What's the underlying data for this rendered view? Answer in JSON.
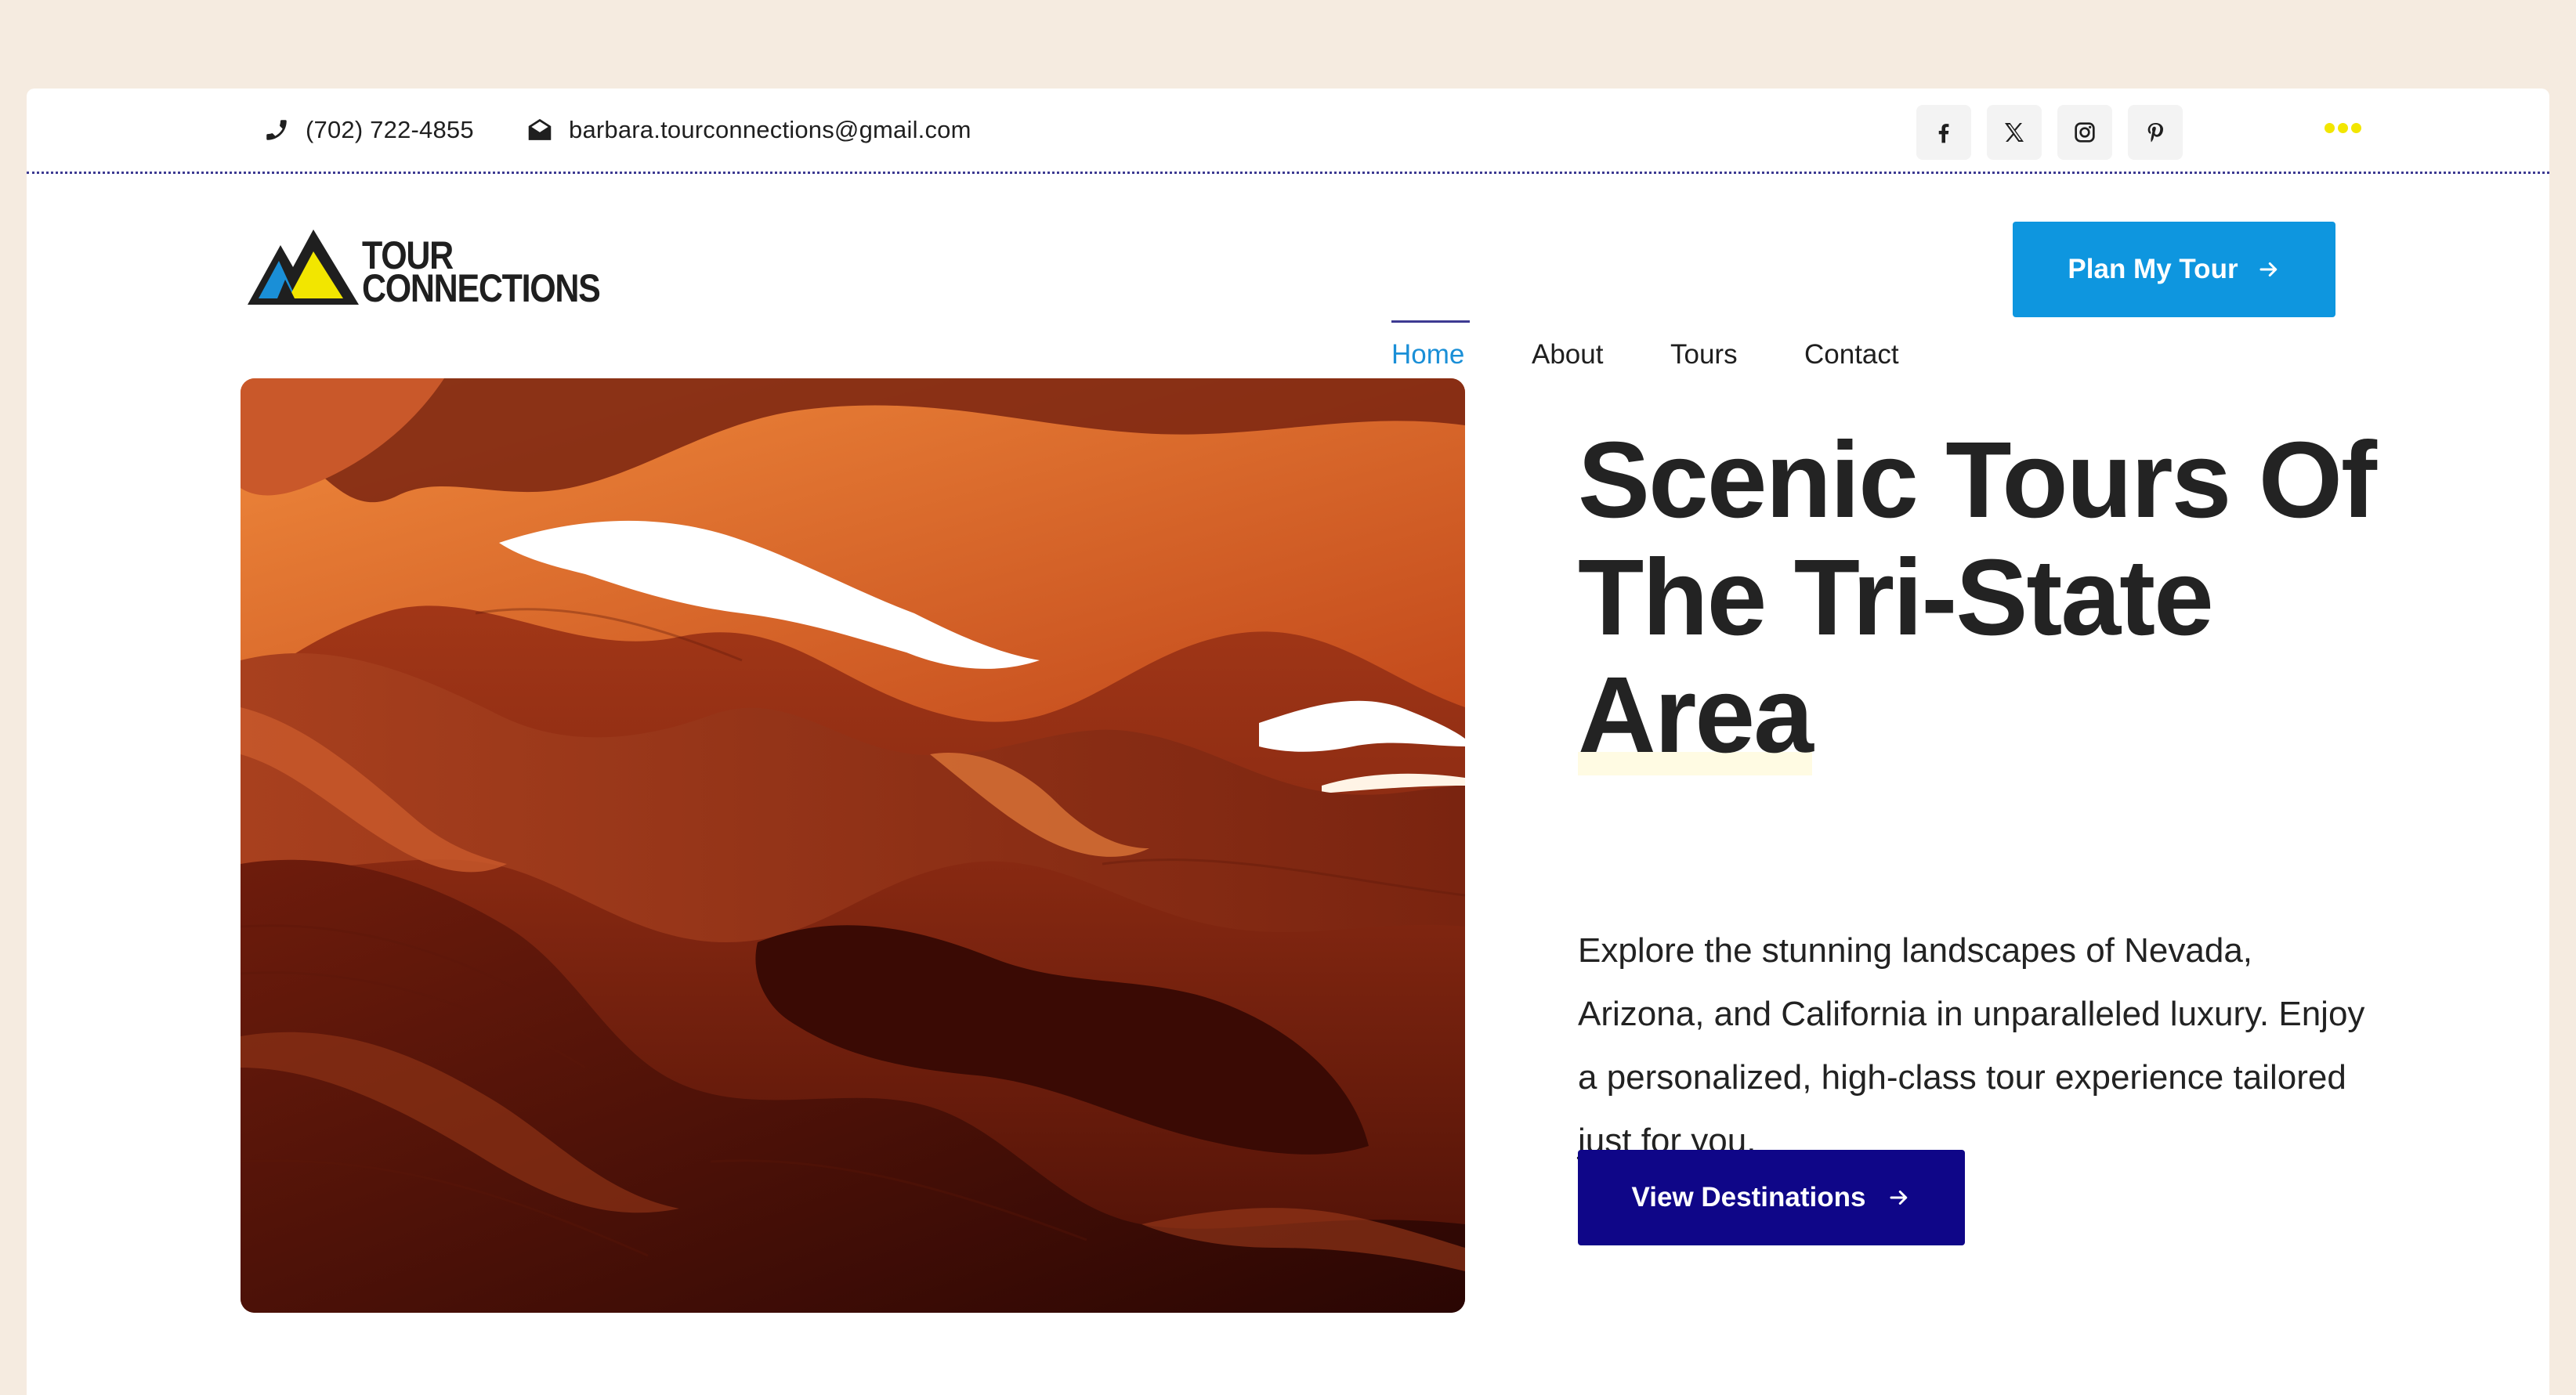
{
  "topbar": {
    "phone": "(702) 722-4855",
    "email": "barbara.tourconnections@gmail.com",
    "socials": [
      {
        "name": "facebook-icon"
      },
      {
        "name": "x-icon"
      },
      {
        "name": "instagram-icon"
      },
      {
        "name": "pinterest-icon"
      }
    ],
    "more_menu_icon": "more-dots-icon"
  },
  "logo": {
    "line1": "TOUR",
    "line2": "CONNECTIONS"
  },
  "nav": {
    "items": [
      {
        "label": "Home",
        "active": true
      },
      {
        "label": "About",
        "active": false
      },
      {
        "label": "Tours",
        "active": false
      },
      {
        "label": "Contact",
        "active": false
      }
    ],
    "cta": "Plan My Tour"
  },
  "hero": {
    "headline_part1": "Scenic Tours Of The Tri-State ",
    "headline_highlight": "Area",
    "description": "Explore the stunning landscapes of Nevada, Arizona, and California in unparalleled luxury. Enjoy a personalized, high-class tour experience tailored just for you.",
    "cta": "View Destinations",
    "image": "slot-canyon-photo"
  },
  "colors": {
    "page_bg": "#f5ebe0",
    "brand_blue": "#0e96df",
    "brand_navy": "#0f0688",
    "accent_yellow": "#f2e600",
    "nav_active": "#1a8fd7"
  }
}
